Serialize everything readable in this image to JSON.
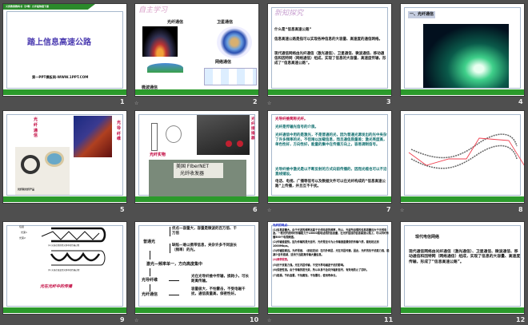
{
  "slides": [
    {
      "num": "1",
      "banner": "义务教育教科书（沪粤）九年级物理下册",
      "title": "踏上信息高速公路",
      "subtitle": "第一PPT模板网-WWW.1PPT.COM"
    },
    {
      "num": "2",
      "heading": "自主学习",
      "labels": [
        "光纤通信",
        "卫星通信",
        "网络通信",
        "微波通信"
      ]
    },
    {
      "num": "3",
      "heading": "新知探究",
      "question": "什么是“信息高速公路”",
      "p1": "信息高速公路是指可以实现各种信息的大容量、高速度的通信网络。",
      "p2": "现代通信网络由光纤通信（激光通信）、卫星通信、微波通信、移动通信和因特网（网络通信）组成，实现了信息的大容量、高速度传输，形成了“信息高速公路”。"
    },
    {
      "num": "4",
      "heading": "一、光纤通信"
    },
    {
      "num": "5",
      "labels": [
        "光纤通信",
        "光导纤维",
        "光纤"
      ],
      "caption": "光纤和光纤产品"
    },
    {
      "num": "6",
      "labels": [
        "光纤实物",
        "光纤接插器"
      ],
      "sign1": "美国 FIberNET",
      "sign2": "光纤收发器"
    },
    {
      "num": "7",
      "bullets": [
        "光导纤维简称光纤。",
        "光纤是传输光信号的介质。",
        "光纤通信中用的是激光，不是普通的光，因为普通光源发出的光中夹杂了许多频率的光，不但难以加载信息，而且通信质量差；激光亮度高，单色性好，方向性好，能量的集中在传播方向上，容易调制信号。",
        "光导纤维中激光是以不断反射的方式向前传播的，因而光缆也可以不沿直线铺设。",
        "电话、电视、广播等信号以及数据文件可以在光纤构成的“信息高速公路”上传播，并且互不干扰。"
      ]
    },
    {
      "num": "8"
    },
    {
      "num": "9",
      "labels": [
        "包层",
        "光束1",
        "光束2"
      ],
      "cap_a": "(a) 光束在阶跃型光纤中的传输过程",
      "cap_b": "(b) 光束在渐变型光纤中的传输过程",
      "title": "光在光纤中的传播"
    },
    {
      "num": "10",
      "n1": "普通光",
      "adv": "优点—容量大，容量是微波的百万倍、千万倍",
      "dis": "缺陷—难以携带信息，夹杂许多不同波长（频率）的光。",
      "n2": "激光—频率单一，方向高度集中",
      "n3": "光导纤维",
      "d3": "光在光导纤维中传输，损耗小，可长距离传输。",
      "n4": "光纤通信",
      "d4": "容量极大，不怕雷击，不受电磁干扰，通信质量高，保密性好。"
    },
    {
      "num": "11",
      "heading": "光纤的特点：",
      "items": [
        "(1)信息容量大。由于光波的频率远高于无线电波的频率，所以，光波所运载的信息容量远大于无线电波。一根光纤按同时传输能力于10000路电话线的信息量，在光纤组成的信息高速公路上，可以同时传播500个电视频道。",
        "(2)传输速度快。因为传输的是光信号，光纤是至今为止传输速度最快的传输介质，能轻松达到1000Mbps。",
        "(3)传输距离远。光纤很细，（细如发丝）在内外两层，光在内层传播，因此，光纤的抗干扰能力强，能减少信号衰减，适用于远距离传输大量信息。",
        "(4)频带很宽。",
        "(5)抗干扰能力强。光在内层传输，不受外界电磁波干扰的影响。",
        "(6)保密性强。由于传输的是光束，所以本身不会向外辐射信号，有效地防止了窃听。",
        "(7)能源。节约金属，不怕腐蚀，不怕雷击，使用寿命长。"
      ]
    },
    {
      "num": "12",
      "heading": "现代电信网络",
      "body": "现代通信网络由光纤通信（激光通信）、卫星通信、微波通信、移动通信和因特网（网络通信）组成，实现了信息的大容量、高速度传输，形成了“信息高速公路”。"
    }
  ],
  "anim_icon_label": "☆"
}
